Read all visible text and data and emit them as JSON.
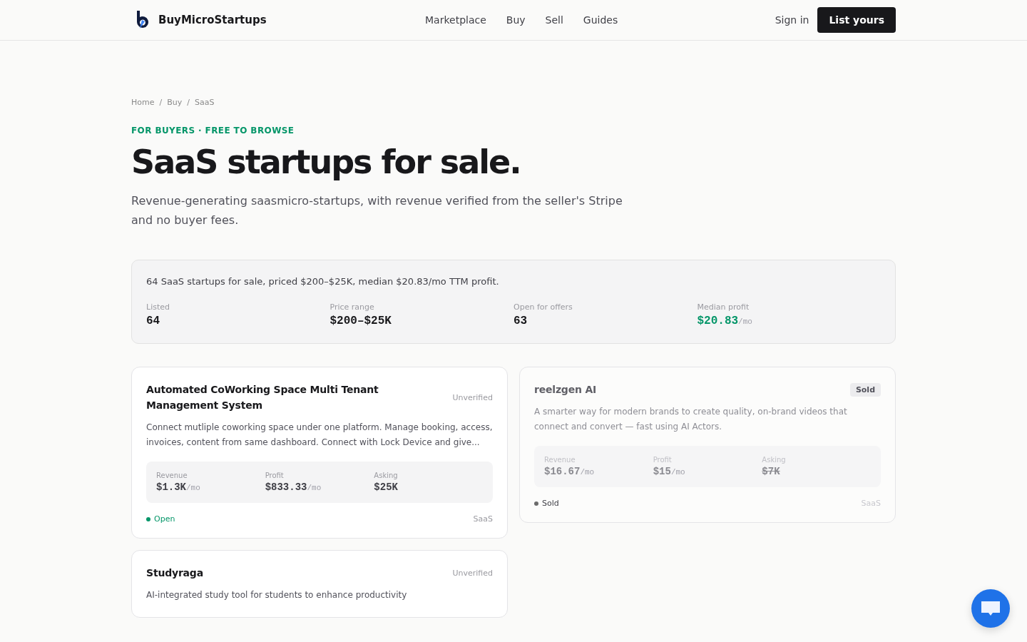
{
  "header": {
    "brand": "BuyMicroStartups",
    "nav": [
      {
        "label": "Marketplace"
      },
      {
        "label": "Buy"
      },
      {
        "label": "Sell"
      },
      {
        "label": "Guides"
      }
    ],
    "sign_in": "Sign in",
    "cta": "List yours"
  },
  "breadcrumb": {
    "separator": "/",
    "items": [
      "Home",
      "Buy",
      "SaaS"
    ]
  },
  "eyebrow": "FOR BUYERS · FREE TO BROWSE",
  "title": "SaaS startups for sale.",
  "subtitle": "Revenue-generating saasmicro-startups, with revenue verified from the seller's Stripe and no buyer fees.",
  "summary": {
    "text": "64 SaaS startups for sale, priced $200–$25K, median $20.83/mo TTM profit.",
    "stats": [
      {
        "label": "Listed",
        "value": "64",
        "kind": "plain"
      },
      {
        "label": "Price range",
        "value": "$200–$25K",
        "kind": "plain"
      },
      {
        "label": "Open for offers",
        "value": "63",
        "kind": "plain"
      },
      {
        "label": "Median profit",
        "value": "$20.83",
        "unit": "/mo",
        "kind": "highlight"
      }
    ]
  },
  "listings": [
    {
      "title": "Automated CoWorking Space Multi Tenant Management System",
      "badge": {
        "label": "Unverified",
        "kind": "plain"
      },
      "sold": false,
      "description": "Connect mutliple coworking space under one platform. Manage booking, access, invoices, content from same dashboard. Connect with Lock Device and give...",
      "metrics": [
        {
          "label": "Revenue",
          "value": "$1.3K",
          "unit": "/mo"
        },
        {
          "label": "Profit",
          "value": "$833.33",
          "unit": "/mo"
        },
        {
          "label": "Asking",
          "value": "$25K"
        }
      ],
      "status": {
        "label": "Open",
        "color": "#059669"
      },
      "category": "SaaS"
    },
    {
      "title": "reelzgen AI",
      "badge": {
        "label": "Sold",
        "kind": "pill"
      },
      "sold": true,
      "description": "A smarter way for modern brands to create quality, on-brand videos that connect and convert — fast using AI Actors.",
      "metrics": [
        {
          "label": "Revenue",
          "value": "$16.67",
          "unit": "/mo"
        },
        {
          "label": "Profit",
          "value": "$15",
          "unit": "/mo"
        },
        {
          "label": "Asking",
          "value": "$7K"
        }
      ],
      "status": {
        "label": "Sold",
        "color": "#6b6b6b"
      },
      "category": "SaaS"
    },
    {
      "title": "Studyraga",
      "badge": {
        "label": "Unverified",
        "kind": "plain"
      },
      "sold": false,
      "description": "AI-integrated study tool for students to enhance productivity"
    }
  ]
}
